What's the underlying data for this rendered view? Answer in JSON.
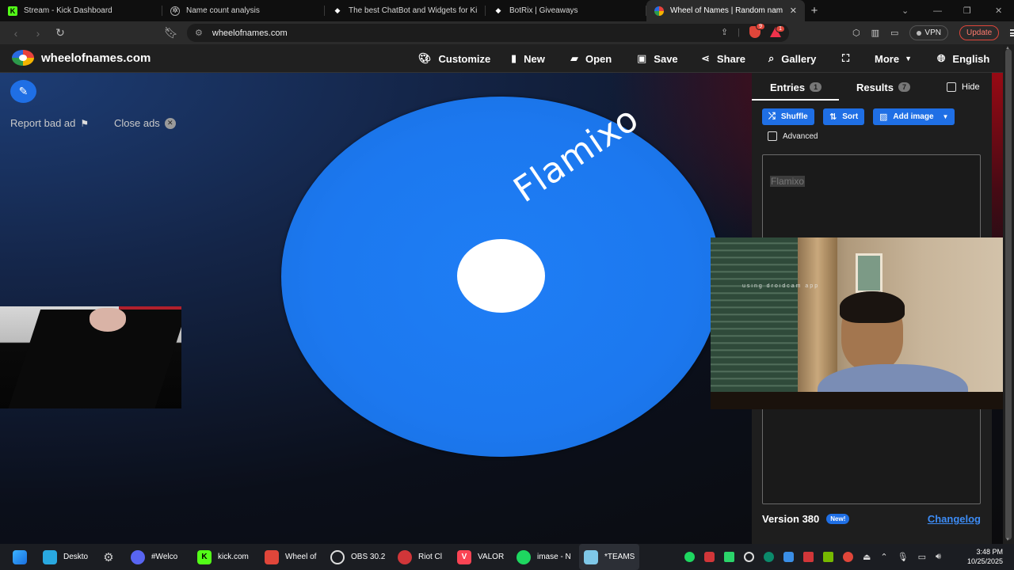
{
  "browser": {
    "tabs": [
      {
        "label": "Stream - Kick Dashboard",
        "icon": "kick-icon",
        "active": false
      },
      {
        "label": "Name count analysis",
        "icon": "chatgpt-icon",
        "active": false
      },
      {
        "label": "The best ChatBot and Widgets for Ki",
        "icon": "botrix-icon",
        "active": false
      },
      {
        "label": "BotRix | Giveaways",
        "icon": "botrix-icon",
        "active": false
      },
      {
        "label": "Wheel of Names | Random nam",
        "icon": "wheelofnames-icon",
        "active": true
      }
    ],
    "url": "wheelofnames.com",
    "shield_badge": "9",
    "rewards_badge": "1",
    "vpn_label": "VPN",
    "update_label": "Update"
  },
  "site": {
    "logo_text": "wheelofnames.com",
    "menu": {
      "customize": "Customize",
      "new": "New",
      "open": "Open",
      "save": "Save",
      "share": "Share",
      "gallery": "Gallery",
      "more": "More",
      "language": "English"
    }
  },
  "stage": {
    "report_ad": "Report bad ad",
    "close_ads": "Close ads",
    "wheel_entry": "Flamixo",
    "wheel_color": "#1e7ef5",
    "webcam_watermark": "using droidcam app"
  },
  "panel": {
    "tab_entries": "Entries",
    "entries_count": "1",
    "tab_results": "Results",
    "results_count": "7",
    "hide_label": "Hide",
    "shuffle": "Shuffle",
    "sort": "Sort",
    "add_image": "Add image",
    "advanced": "Advanced",
    "entries": [
      "Flamixo"
    ],
    "version": "Version 380",
    "new_badge": "New!",
    "changelog": "Changelog"
  },
  "taskbar": {
    "items": [
      "Deskto",
      "#Welco",
      "kick.com",
      "Wheel of",
      "OBS 30.2",
      "Riot Cl",
      "VALOR",
      "imase - N",
      "*TEAMS"
    ],
    "time": "3:48 PM",
    "date": "10/25/2025"
  },
  "colors": {
    "accent": "#1f6fe5",
    "link": "#3d8cf5",
    "header_bg": "#202020",
    "panel_bg": "#1e1e1e"
  }
}
